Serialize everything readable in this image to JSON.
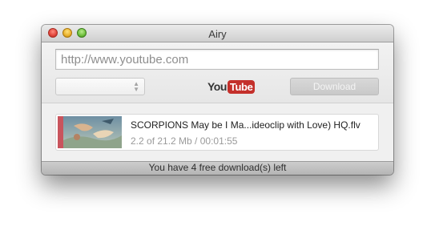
{
  "window": {
    "title": "Airy"
  },
  "toolbar": {
    "url_placeholder": "http://www.youtube.com",
    "format_value": "",
    "logo_you": "You",
    "logo_tube": "Tube",
    "download_label": "Download"
  },
  "downloads": [
    {
      "name": "SCORPIONS May be I Ma...ideoclip with Love) HQ.flv",
      "progress": "2.2 of 21.2 Mb / 00:01:55",
      "fraction_done": 0.104
    }
  ],
  "status": {
    "text": "You have 4 free download(s) left"
  },
  "colors": {
    "youtube_red": "#c4302b",
    "thumb_accent": "#c9545d"
  },
  "icons": {
    "close": "red-traffic-light",
    "minimize": "yellow-traffic-light",
    "maximize": "green-traffic-light",
    "select_arrows": "up-down-chevron"
  }
}
